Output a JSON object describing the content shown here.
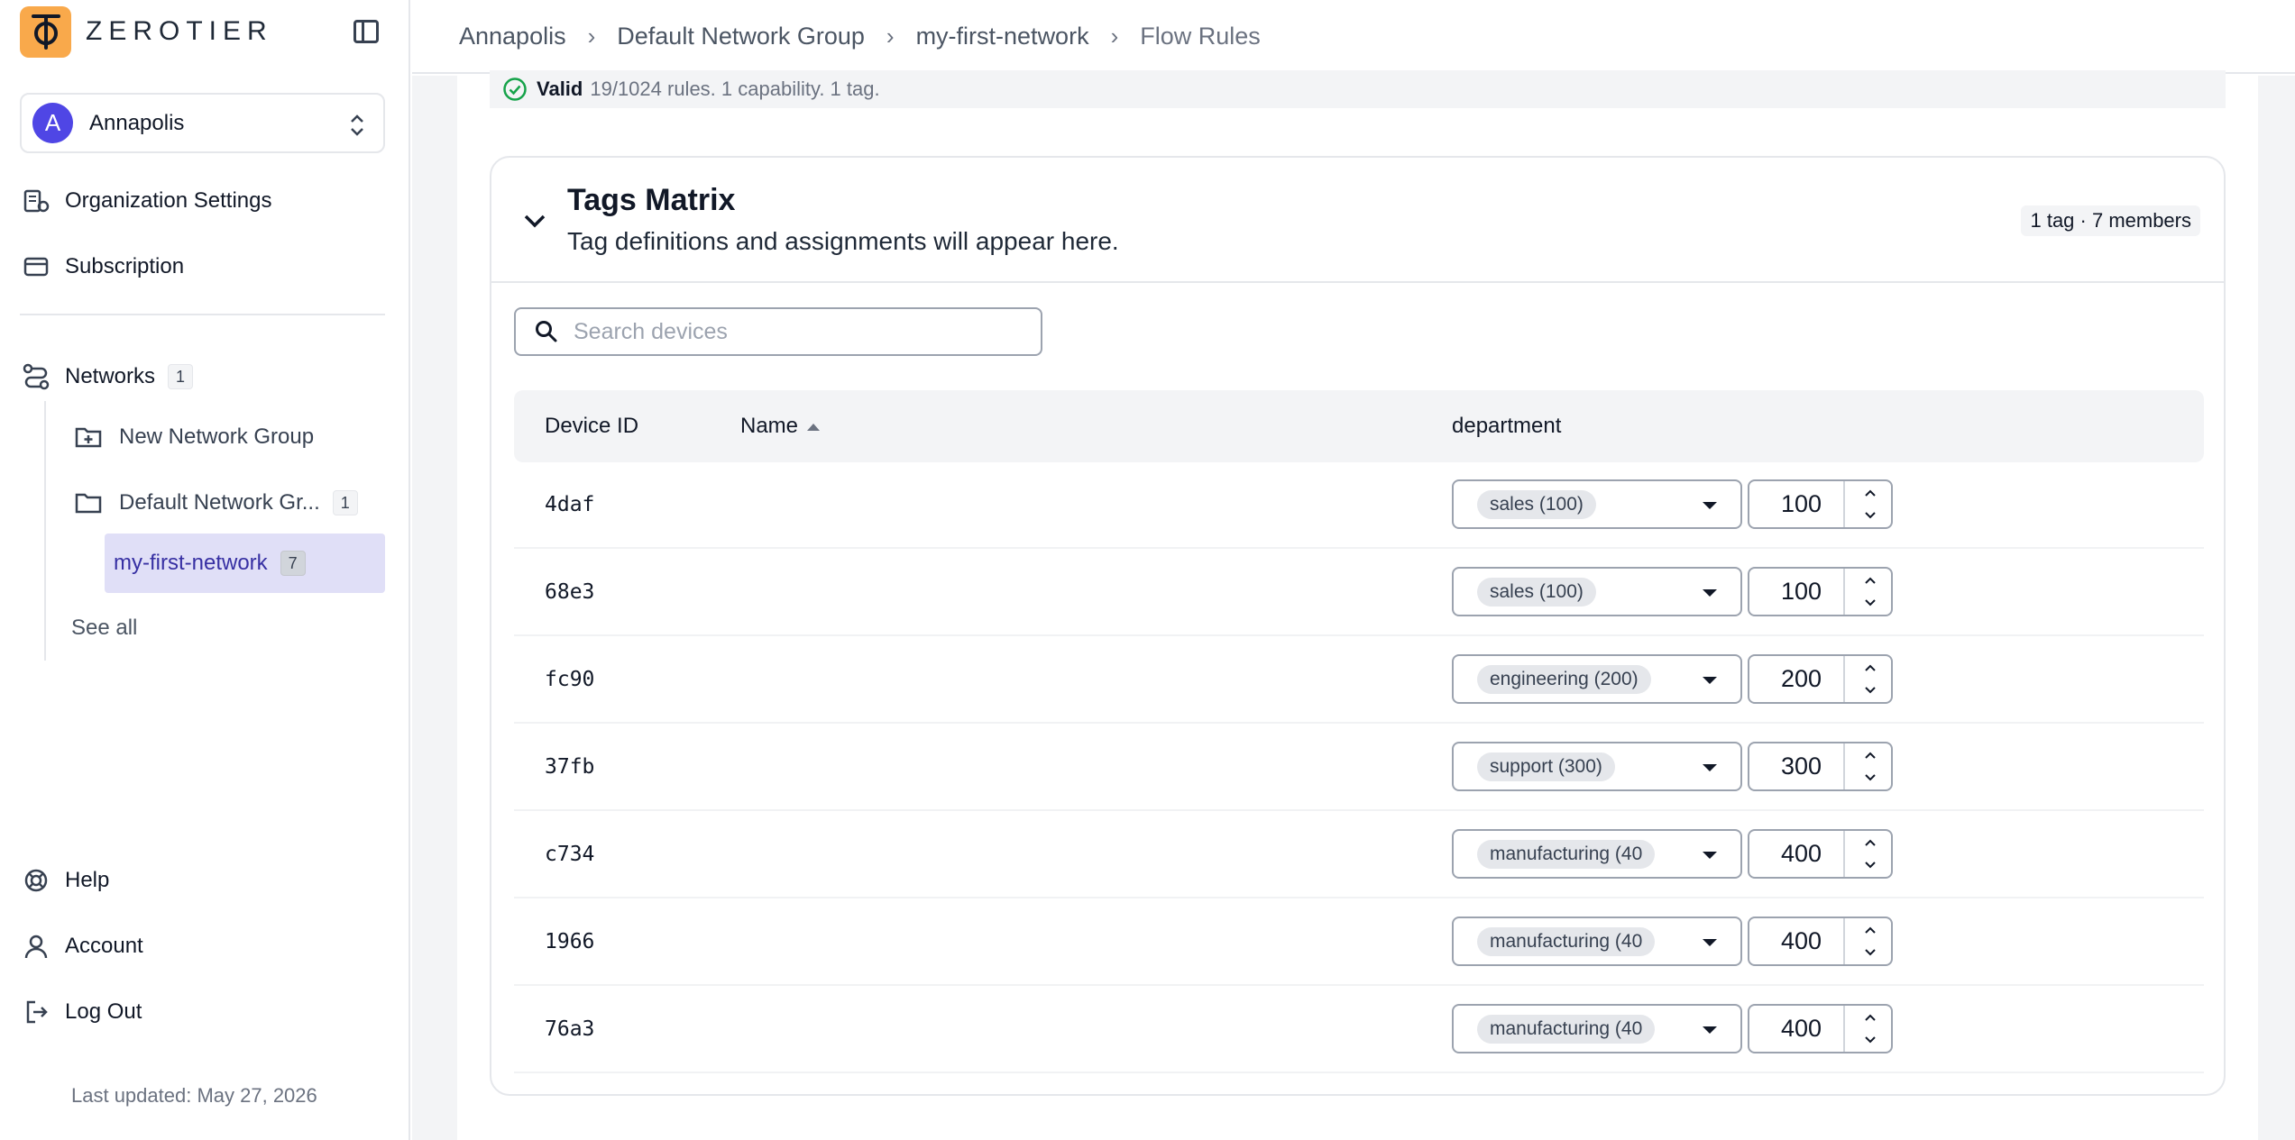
{
  "brand": {
    "name": "ZEROTIER"
  },
  "org_switcher": {
    "avatar_letter": "A",
    "name": "Annapolis"
  },
  "sidebar": {
    "org_settings": "Organization Settings",
    "subscription": "Subscription",
    "networks": {
      "label": "Networks",
      "count": "1"
    },
    "new_network_group": "New Network Group",
    "default_group": {
      "label": "Default Network Gr...",
      "count": "1"
    },
    "active_network": {
      "label": "my-first-network",
      "count": "7"
    },
    "see_all": "See all",
    "help": "Help",
    "account": "Account",
    "logout": "Log Out",
    "last_updated": "Last updated: May 27, 2026"
  },
  "breadcrumb": [
    "Annapolis",
    "Default Network Group",
    "my-first-network",
    "Flow Rules"
  ],
  "validation": {
    "label": "Valid",
    "details": "19/1024 rules. 1 capability. 1 tag."
  },
  "tags_matrix": {
    "title": "Tags Matrix",
    "subtitle": "Tag definitions and assignments will appear here.",
    "meta": "1 tag · 7 members",
    "search_placeholder": "Search devices",
    "columns": {
      "device_id": "Device ID",
      "name": "Name",
      "tag": "department"
    },
    "rows": [
      {
        "device_id": "4daf",
        "name": "",
        "tag_option": "sales (100)",
        "value": "100"
      },
      {
        "device_id": "68e3",
        "name": "",
        "tag_option": "sales (100)",
        "value": "100"
      },
      {
        "device_id": "fc90",
        "name": "",
        "tag_option": "engineering (200)",
        "value": "200"
      },
      {
        "device_id": "37fb",
        "name": "",
        "tag_option": "support (300)",
        "value": "300"
      },
      {
        "device_id": "c734",
        "name": "",
        "tag_option": "manufacturing (40",
        "value": "400"
      },
      {
        "device_id": "1966",
        "name": "",
        "tag_option": "manufacturing (40",
        "value": "400"
      },
      {
        "device_id": "76a3",
        "name": "",
        "tag_option": "manufacturing (40",
        "value": "400"
      }
    ]
  },
  "colors": {
    "accent": "#4f46e5",
    "logo": "#f9a94b",
    "valid": "#16a34a",
    "active_bg": "#e0dff7"
  }
}
